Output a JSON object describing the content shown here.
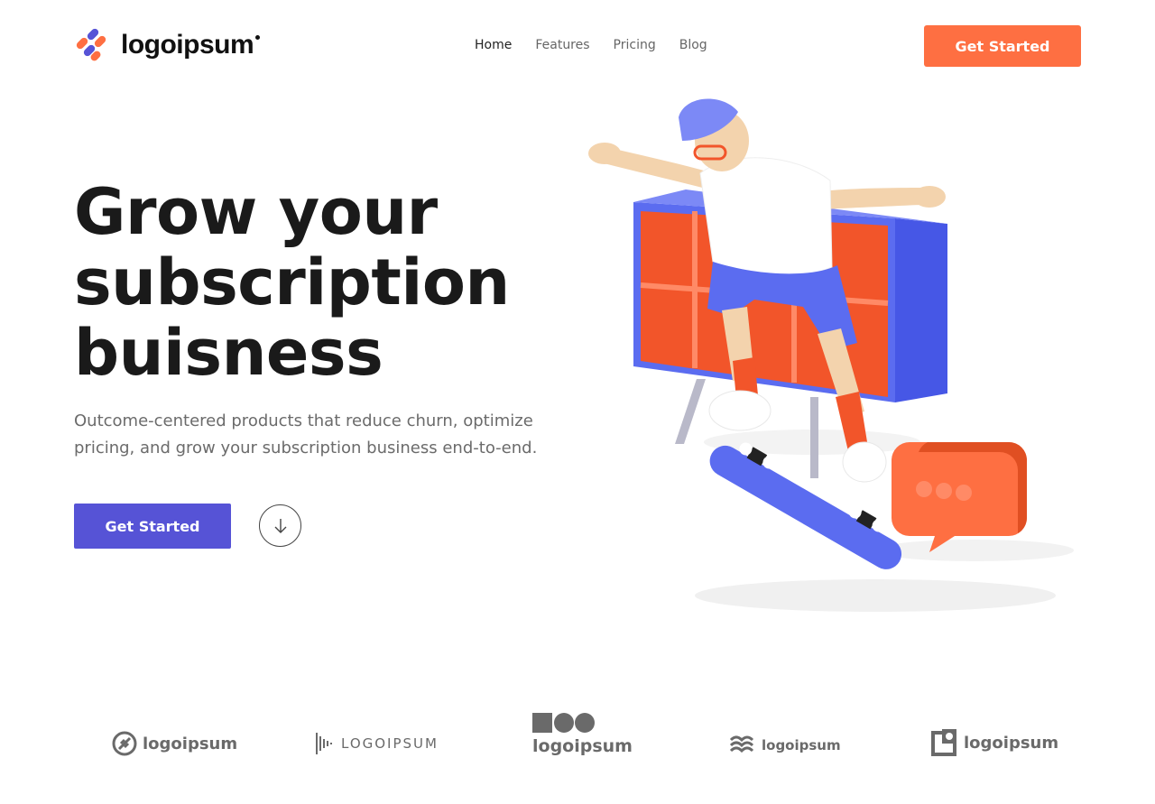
{
  "header": {
    "logo_text": "logoipsum",
    "nav": [
      {
        "label": "Home"
      },
      {
        "label": "Features"
      },
      {
        "label": "Pricing"
      },
      {
        "label": "Blog"
      }
    ],
    "cta_label": "Get Started"
  },
  "hero": {
    "headline_lines": [
      "Grow your",
      "subscription",
      "buisness"
    ],
    "subtitle": "Outcome-centered products that reduce churn, optimize pricing, and grow your subscription business end-to-end.",
    "primary_button": "Get Started",
    "scroll_icon": "arrow-down-icon",
    "illustration": "skateboarder-illustration"
  },
  "partners": [
    {
      "name": "logoipsum",
      "icon": "circle-stripe-logo-icon"
    },
    {
      "name": "LOGOIPSUM",
      "icon": "soundwave-logo-icon"
    },
    {
      "name": "logoipsum",
      "icon": "square-circles-logo-icon"
    },
    {
      "name": "logoipsum",
      "icon": "waves-logo-icon"
    },
    {
      "name": "logoipsum",
      "icon": "square-frame-logo-icon"
    }
  ],
  "colors": {
    "accent_orange": "#fe6f42",
    "accent_purple": "#5653d6",
    "blue": "#5b6cf0"
  }
}
